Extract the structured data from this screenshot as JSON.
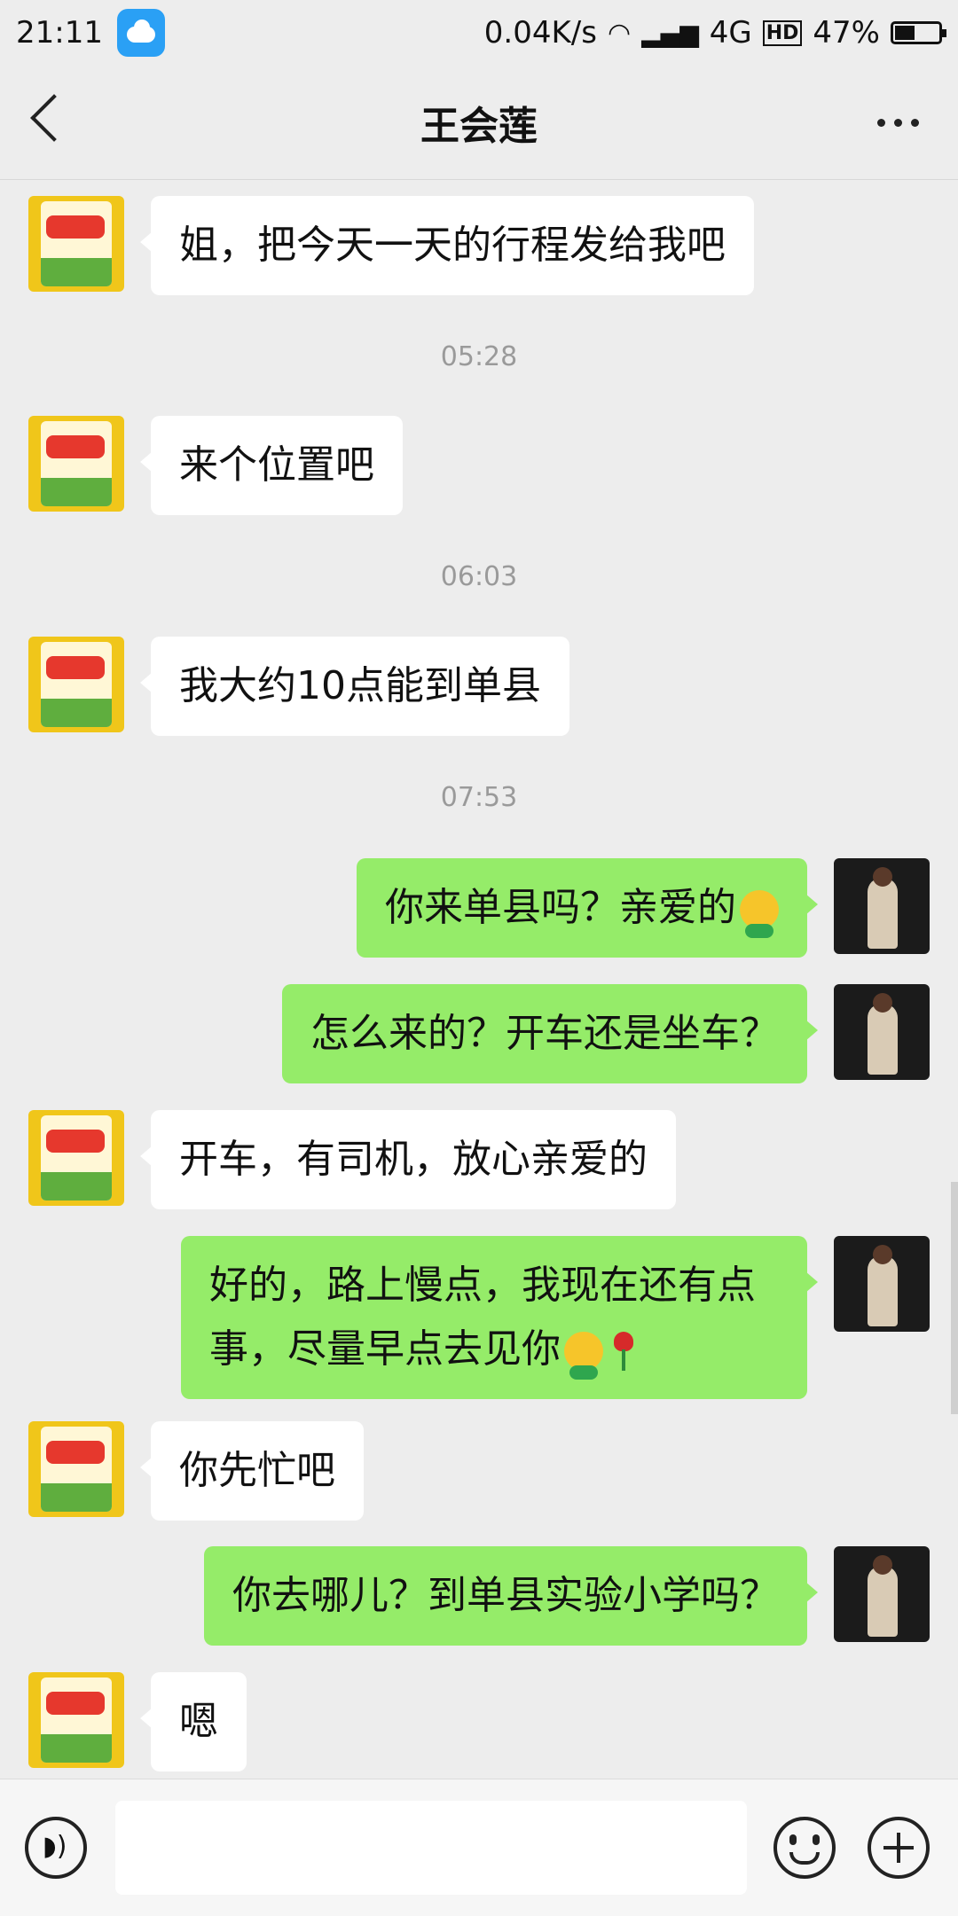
{
  "status_bar": {
    "time": "21:11",
    "net_speed": "0.04K/s",
    "network": "4G",
    "hd": "HD",
    "battery": "47%",
    "battery_level": 0.47
  },
  "header": {
    "title": "王会莲"
  },
  "messages": [
    {
      "type": "in",
      "text": "姐，把今天一天的行程发给我吧"
    },
    {
      "type": "time",
      "text": "05:28"
    },
    {
      "type": "in",
      "text": "来个位置吧"
    },
    {
      "type": "time",
      "text": "06:03"
    },
    {
      "type": "in",
      "text": "我大约10点能到单县"
    },
    {
      "type": "time",
      "text": "07:53"
    },
    {
      "type": "out",
      "text": "你来单县吗？亲爱的"
    },
    {
      "type": "out",
      "text": "怎么来的？开车还是坐车？"
    },
    {
      "type": "in",
      "text": "开车，有司机，放心亲爱的"
    },
    {
      "type": "out",
      "text": "好的，路上慢点，我现在还有点事，尽量早点去见你"
    },
    {
      "type": "in",
      "text": "你先忙吧"
    },
    {
      "type": "out",
      "text": "你去哪儿？到单县实验小学吗？"
    },
    {
      "type": "in",
      "text": "嗯"
    }
  ],
  "icons": {
    "weather": "weather-icon",
    "back": "back-arrow-icon",
    "more": "more-icon",
    "voice": "voice-icon",
    "emoji": "emoji-icon",
    "plus": "plus-icon"
  },
  "colors": {
    "outgoing_bubble": "#95ec69",
    "incoming_bubble": "#ffffff",
    "background": "#ededed"
  }
}
